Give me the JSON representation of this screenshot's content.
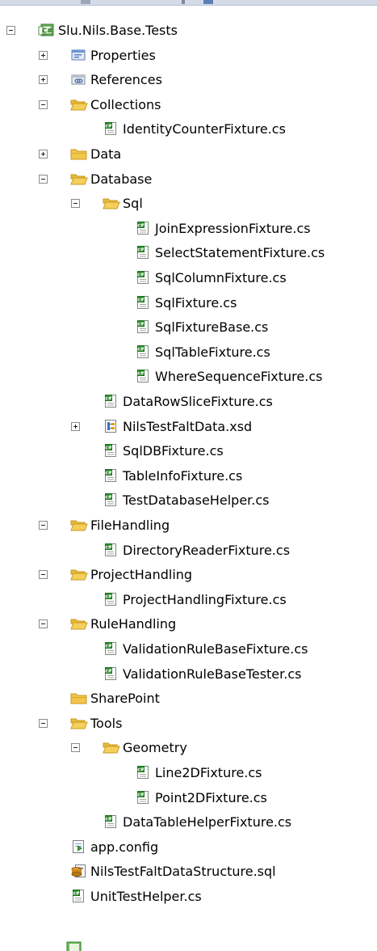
{
  "solution_explorer": {
    "nodes": [
      {
        "label": "Slu.Nils.Base.Tests",
        "depth": 0,
        "toggle": "minus",
        "icon": "csharp-project-icon"
      },
      {
        "label": "Properties",
        "depth": 1,
        "toggle": "plus",
        "icon": "properties-icon"
      },
      {
        "label": "References",
        "depth": 1,
        "toggle": "plus",
        "icon": "references-icon"
      },
      {
        "label": "Collections",
        "depth": 1,
        "toggle": "minus",
        "icon": "folder-open-icon"
      },
      {
        "label": "IdentityCounterFixture.cs",
        "depth": 2,
        "toggle": "none",
        "icon": "csharp-file-icon"
      },
      {
        "label": "Data",
        "depth": 1,
        "toggle": "plus",
        "icon": "folder-closed-icon"
      },
      {
        "label": "Database",
        "depth": 1,
        "toggle": "minus",
        "icon": "folder-open-icon"
      },
      {
        "label": "Sql",
        "depth": 2,
        "toggle": "minus",
        "icon": "folder-open-icon"
      },
      {
        "label": "JoinExpressionFixture.cs",
        "depth": 3,
        "toggle": "none",
        "icon": "csharp-file-icon"
      },
      {
        "label": "SelectStatementFixture.cs",
        "depth": 3,
        "toggle": "none",
        "icon": "csharp-file-icon"
      },
      {
        "label": "SqlColumnFixture.cs",
        "depth": 3,
        "toggle": "none",
        "icon": "csharp-file-icon"
      },
      {
        "label": "SqlFixture.cs",
        "depth": 3,
        "toggle": "none",
        "icon": "csharp-file-icon"
      },
      {
        "label": "SqlFixtureBase.cs",
        "depth": 3,
        "toggle": "none",
        "icon": "csharp-file-icon"
      },
      {
        "label": "SqlTableFixture.cs",
        "depth": 3,
        "toggle": "none",
        "icon": "csharp-file-icon"
      },
      {
        "label": "WhereSequenceFixture.cs",
        "depth": 3,
        "toggle": "none",
        "icon": "csharp-file-icon"
      },
      {
        "label": "DataRowSliceFixture.cs",
        "depth": 2,
        "toggle": "none",
        "icon": "csharp-file-icon"
      },
      {
        "label": "NilsTestFaltData.xsd",
        "depth": 2,
        "toggle": "plus",
        "icon": "xsd-file-icon"
      },
      {
        "label": "SqlDBFixture.cs",
        "depth": 2,
        "toggle": "none",
        "icon": "csharp-file-icon"
      },
      {
        "label": "TableInfoFixture.cs",
        "depth": 2,
        "toggle": "none",
        "icon": "csharp-file-icon"
      },
      {
        "label": "TestDatabaseHelper.cs",
        "depth": 2,
        "toggle": "none",
        "icon": "csharp-file-icon"
      },
      {
        "label": "FileHandling",
        "depth": 1,
        "toggle": "minus",
        "icon": "folder-open-icon"
      },
      {
        "label": "DirectoryReaderFixture.cs",
        "depth": 2,
        "toggle": "none",
        "icon": "csharp-file-icon"
      },
      {
        "label": "ProjectHandling",
        "depth": 1,
        "toggle": "minus",
        "icon": "folder-open-icon"
      },
      {
        "label": "ProjectHandlingFixture.cs",
        "depth": 2,
        "toggle": "none",
        "icon": "csharp-file-icon"
      },
      {
        "label": "RuleHandling",
        "depth": 1,
        "toggle": "minus",
        "icon": "folder-open-icon"
      },
      {
        "label": "ValidationRuleBaseFixture.cs",
        "depth": 2,
        "toggle": "none",
        "icon": "csharp-file-icon"
      },
      {
        "label": "ValidationRuleBaseTester.cs",
        "depth": 2,
        "toggle": "none",
        "icon": "csharp-file-icon"
      },
      {
        "label": "SharePoint",
        "depth": 1,
        "toggle": "none",
        "icon": "folder-closed-icon"
      },
      {
        "label": "Tools",
        "depth": 1,
        "toggle": "minus",
        "icon": "folder-open-icon"
      },
      {
        "label": "Geometry",
        "depth": 2,
        "toggle": "minus",
        "icon": "folder-open-icon"
      },
      {
        "label": "Line2DFixture.cs",
        "depth": 3,
        "toggle": "none",
        "icon": "csharp-file-icon"
      },
      {
        "label": "Point2DFixture.cs",
        "depth": 3,
        "toggle": "none",
        "icon": "csharp-file-icon"
      },
      {
        "label": "DataTableHelperFixture.cs",
        "depth": 2,
        "toggle": "none",
        "icon": "csharp-file-icon"
      },
      {
        "label": "app.config",
        "depth": 1,
        "toggle": "none",
        "icon": "config-file-icon"
      },
      {
        "label": "NilsTestFaltDataStructure.sql",
        "depth": 1,
        "toggle": "none",
        "icon": "sql-file-icon"
      },
      {
        "label": "UnitTestHelper.cs",
        "depth": 1,
        "toggle": "none",
        "icon": "csharp-file-icon"
      }
    ]
  },
  "colors": {
    "folder": "#f1c64a",
    "folder_dark": "#c99a1f",
    "csharp_green": "#2f8f2f",
    "project_green": "#4a9a3a"
  }
}
